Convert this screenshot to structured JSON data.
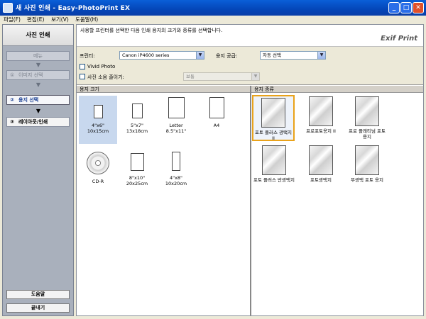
{
  "window": {
    "title": "새 사진 인쇄 - Easy-PhotoPrint EX"
  },
  "menu": [
    "파일(F)",
    "편집(E)",
    "보기(V)",
    "도움말(H)"
  ],
  "sidebar": {
    "heading": "사진 인쇄",
    "steps": [
      {
        "label": "메뉴",
        "num": ""
      },
      {
        "label": "이미지 선택",
        "num": "①"
      },
      {
        "label": "용지 선택",
        "num": "②"
      },
      {
        "label": "레이아웃/인쇄",
        "num": "③"
      }
    ],
    "help_label": "도움말",
    "exit_label": "끝내기"
  },
  "main": {
    "instruction": "사용할 프린터를 선택한 다음 인쇄 용지의 크기와 종류를 선택합니다.",
    "logo": "Exif Print",
    "printer_label": "프린터:",
    "printer_value": "Canon iP4600 series",
    "paper_source_label": "용지 공급:",
    "paper_source_value": "자동 선택",
    "vivid_label": "Vivid Photo",
    "noise_label": "사진 소음 줄이기:",
    "noise_value": "보통",
    "paper_size_header": "용지 크기",
    "media_type_header": "용지 종류"
  },
  "paper_sizes": [
    {
      "name": "4\"x6\"",
      "sub": "10x15cm",
      "selected": true
    },
    {
      "name": "5\"x7\"",
      "sub": "13x18cm",
      "selected": false
    },
    {
      "name": "Letter",
      "sub": "8.5\"x11\"",
      "selected": false
    },
    {
      "name": "A4",
      "sub": "",
      "selected": false
    },
    {
      "name": "CD-R",
      "sub": "",
      "selected": false
    },
    {
      "name": "8\"x10\"",
      "sub": "20x25cm",
      "selected": false
    },
    {
      "name": "4\"x8\"",
      "sub": "10x20cm",
      "selected": false
    }
  ],
  "media_types": [
    {
      "name": "포토 플러스 광택지 II",
      "selected": true
    },
    {
      "name": "프로포토용지 II",
      "selected": false
    },
    {
      "name": "프로 플래티넘 포토 용지",
      "selected": false
    },
    {
      "name": "포토 플러스 반광택지",
      "selected": false
    },
    {
      "name": "포토광택지",
      "selected": false
    },
    {
      "name": "무광택 포토 용지",
      "selected": false
    }
  ],
  "colors": {
    "title_bar": "#0446b8",
    "selection": "#e9a21a",
    "sidebar": "#a9b0bc"
  }
}
